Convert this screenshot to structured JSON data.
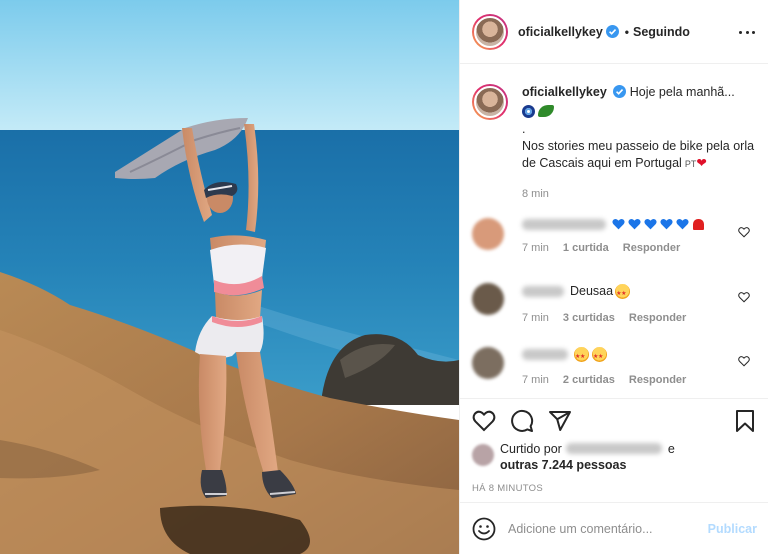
{
  "colors": {
    "accent": "#0095f6",
    "publish_disabled": "#b3dbff",
    "muted_text": "#8e8e8e",
    "border": "#efefef",
    "verified": "#3897f0"
  },
  "header": {
    "username": "oficialkellykey",
    "separator": "•",
    "follow_status": "Seguindo",
    "more_icon": "more-horizontal-icon"
  },
  "caption": {
    "username": "oficialkellykey",
    "line1": "Hoje pela manhã...",
    "line2": ".",
    "line3": "Nos stories meu passeio de bike pela orla de Cascais aqui em Portugal",
    "flag": "PT",
    "time": "8 min"
  },
  "comments": [
    {
      "text": "",
      "time": "7 min",
      "likes": "1 curtida",
      "reply": "Responder"
    },
    {
      "text": "Deusaa",
      "time": "7 min",
      "likes": "3 curtidas",
      "reply": "Responder"
    },
    {
      "text": "",
      "time": "7 min",
      "likes": "2 curtidas",
      "reply": "Responder"
    }
  ],
  "likes": {
    "prefix": "Curtido por",
    "connector": "e",
    "others": "outras 7.244 pessoas"
  },
  "post_age": "HÁ 8 MINUTOS",
  "add_comment": {
    "placeholder": "Adicione um comentário...",
    "publish": "Publicar"
  }
}
